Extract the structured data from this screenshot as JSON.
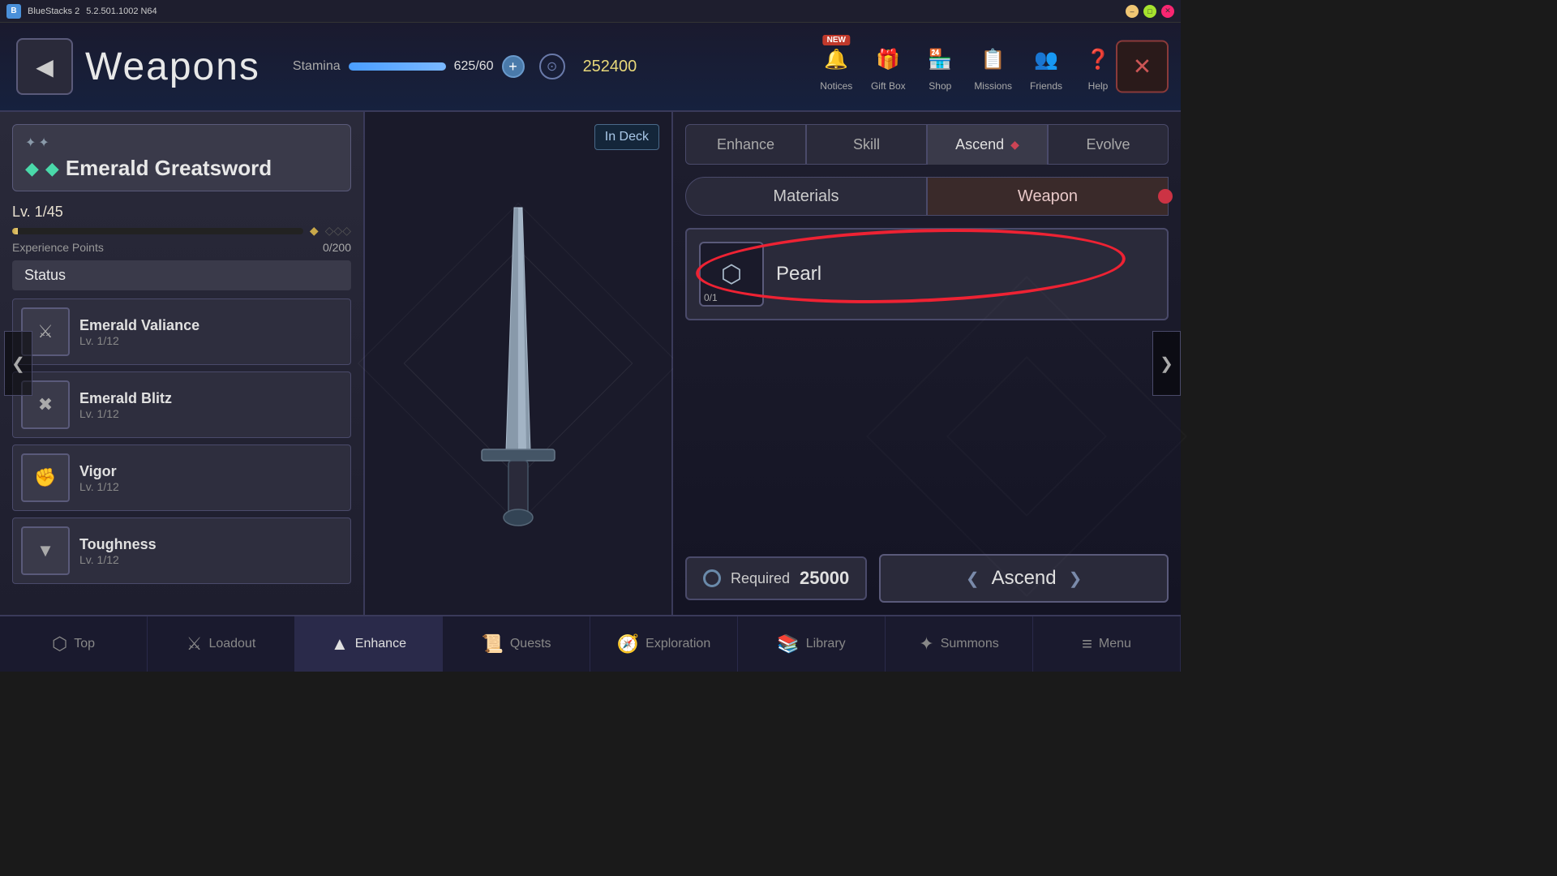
{
  "titlebar": {
    "app_name": "BlueStacks 2",
    "version": "5.2.501.1002 N64",
    "minimize_label": "–",
    "maximize_label": "□",
    "close_label": "✕"
  },
  "header": {
    "back_label": "◀",
    "title": "Weapons",
    "stamina_label": "Stamina",
    "stamina_current": "625",
    "stamina_max": "60",
    "stamina_display": "625/60",
    "stamina_fill_pct": "100",
    "stamina_plus": "+",
    "currency": "252400",
    "close_label": "✕"
  },
  "top_nav": {
    "items": [
      {
        "id": "notices",
        "icon": "🔔",
        "label": "Notices",
        "badge": "NEW"
      },
      {
        "id": "giftbox",
        "icon": "🎁",
        "label": "Gift Box",
        "badge": null
      },
      {
        "id": "shop",
        "icon": "🏪",
        "label": "Shop",
        "badge": null
      },
      {
        "id": "missions",
        "icon": "📋",
        "label": "Missions",
        "badge": null
      },
      {
        "id": "friends",
        "icon": "👥",
        "label": "Friends",
        "badge": null
      },
      {
        "id": "help",
        "icon": "❓",
        "label": "Help",
        "badge": null
      }
    ]
  },
  "weapon": {
    "stars": [
      "★",
      "★"
    ],
    "gem1": "◆",
    "gem2": "◆",
    "name": "Emerald Greatsword",
    "level_current": "1",
    "level_max": "45",
    "level_display": "Lv. 1/45",
    "exp_label": "Experience Points",
    "exp_current": "0",
    "exp_max": "200",
    "exp_display": "0/200",
    "in_deck_label": "In Deck"
  },
  "status": {
    "label": "Status",
    "skills": [
      {
        "id": "emerald-valiance",
        "icon": "⚔",
        "name": "Emerald Valiance",
        "level": "Lv. 1/12"
      },
      {
        "id": "emerald-blitz",
        "icon": "✖",
        "name": "Emerald Blitz",
        "level": "Lv. 1/12"
      },
      {
        "id": "vigor",
        "icon": "✊",
        "name": "Vigor",
        "level": "Lv. 1/12"
      },
      {
        "id": "toughness",
        "icon": "▼",
        "name": "Toughness",
        "level": "Lv. 1/12"
      }
    ]
  },
  "tabs": [
    {
      "id": "enhance",
      "label": "Enhance"
    },
    {
      "id": "skill",
      "label": "Skill"
    },
    {
      "id": "ascend",
      "label": "Ascend",
      "active": true
    },
    {
      "id": "evolve",
      "label": "Evolve"
    }
  ],
  "sub_tabs": [
    {
      "id": "materials",
      "label": "Materials"
    },
    {
      "id": "weapon",
      "label": "Weapon",
      "active": true
    }
  ],
  "ascend": {
    "material_name": "Pearl",
    "material_icon": "⬡",
    "material_count": "0/1",
    "required_label": "Required",
    "required_value": "25000",
    "ascend_btn_label": "Ascend"
  },
  "bottom_nav": [
    {
      "id": "top",
      "icon": "⬡",
      "label": "Top"
    },
    {
      "id": "loadout",
      "icon": "⚔",
      "label": "Loadout"
    },
    {
      "id": "enhance",
      "icon": "▲",
      "label": "Enhance",
      "active": true
    },
    {
      "id": "quests",
      "icon": "📜",
      "label": "Quests"
    },
    {
      "id": "exploration",
      "icon": "🧭",
      "label": "Exploration"
    },
    {
      "id": "library",
      "icon": "📚",
      "label": "Library"
    },
    {
      "id": "summons",
      "icon": "✦",
      "label": "Summons"
    },
    {
      "id": "menu",
      "icon": "≡",
      "label": "Menu"
    }
  ]
}
